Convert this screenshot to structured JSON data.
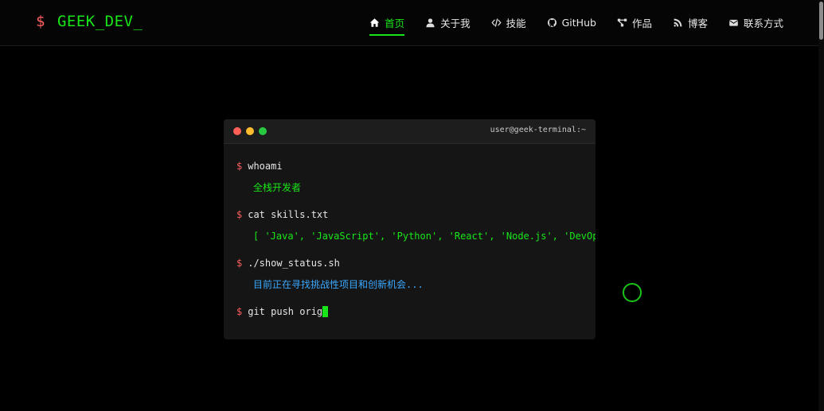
{
  "logo": {
    "prompt": "$",
    "text": "GEEK_DEV_"
  },
  "nav": {
    "items": [
      {
        "label": "首页",
        "icon": "home-icon",
        "active": true
      },
      {
        "label": "关于我",
        "icon": "user-icon"
      },
      {
        "label": "技能",
        "icon": "code-icon"
      },
      {
        "label": "GitHub",
        "icon": "github-icon"
      },
      {
        "label": "作品",
        "icon": "project-diagram-icon"
      },
      {
        "label": "博客",
        "icon": "blog-icon"
      },
      {
        "label": "联系方式",
        "icon": "envelope-icon"
      }
    ]
  },
  "terminal": {
    "title": "user@geek-terminal:~",
    "lines": [
      {
        "prompt": "$",
        "command": "whoami",
        "output": "全栈开发者"
      },
      {
        "prompt": "$",
        "command": "cat skills.txt",
        "output": "[ 'Java', 'JavaScript', 'Python', 'React', 'Node.js', 'DevOps' ]"
      },
      {
        "prompt": "$",
        "command": "./show_status.sh",
        "output": "目前正在寻找挑战性项目和创新机会..."
      },
      {
        "prompt": "$",
        "command": "git push orig"
      }
    ]
  },
  "colors": {
    "accent": "#19e619",
    "prompt": "#ff5f5f",
    "info": "#3aa8ff",
    "background": "#000000"
  }
}
